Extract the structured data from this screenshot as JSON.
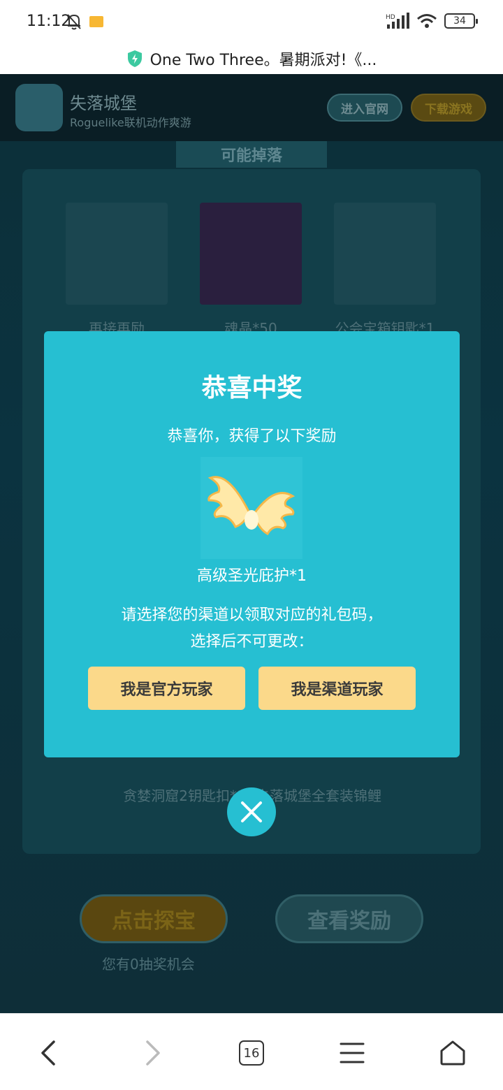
{
  "status": {
    "time": "11:12",
    "battery": "34",
    "network": "HD"
  },
  "browser": {
    "url_title": "One Two Three。暑期派对!《..."
  },
  "banner": {
    "app_name": "失落城堡",
    "app_subtitle": "Roguelike联机动作爽游",
    "official_label": "进入官网",
    "download_label": "下载游戏"
  },
  "drops": {
    "tab_label": "可能掉落",
    "items": [
      {
        "label": "再接再励"
      },
      {
        "label": "魂晶*50"
      },
      {
        "label": "公会宝箱钥匙*1"
      },
      {
        "label": "贪婪洞窟2钥匙扣*1"
      },
      {
        "label": "失落城堡全套装锦鲤"
      }
    ]
  },
  "actions": {
    "treasure_label": "点击探宝",
    "rewards_label": "查看奖励",
    "chances_text": "您有0抽奖机会"
  },
  "modal": {
    "title": "恭喜中奖",
    "subtitle": "恭喜你，获得了以下奖励",
    "prize_name": "高级圣光庇护*1",
    "note_line1": "请选择您的渠道以领取对应的礼包码，",
    "note_line2": "选择后不可更改：",
    "official_button": "我是官方玩家",
    "channel_button": "我是渠道玩家"
  },
  "navbar": {
    "tabs_count": "16"
  },
  "colors": {
    "modal_bg": "#26bfd2",
    "button_bg": "#fbd98a"
  }
}
